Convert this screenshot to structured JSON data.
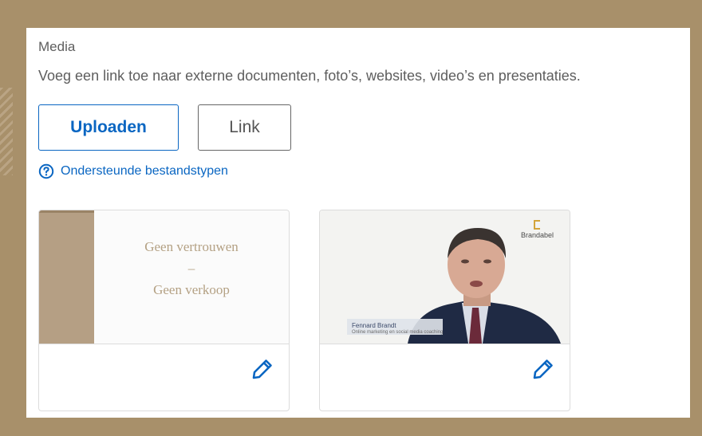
{
  "media": {
    "title": "Media",
    "description": "Voeg een link toe naar externe documenten, foto’s, websites, video’s en presentaties.",
    "upload_label": "Uploaden",
    "link_label": "Link",
    "help_label": "Ondersteunde bestandstypen"
  },
  "cards": [
    {
      "kind": "slide",
      "line1": "Geen vertrouwen",
      "line2": "–",
      "line3": "Geen verkoop",
      "edit_icon": "pencil-icon"
    },
    {
      "kind": "video",
      "logo_text": "Brandabel",
      "lower_name": "Fennard Brandt",
      "lower_sub": "Online marketing en social media coaching",
      "edit_icon": "pencil-icon"
    }
  ],
  "colors": {
    "accent": "#0a66c2",
    "frame": "#a8906a",
    "slide_band": "#b59f84",
    "slide_text": "#b4a184"
  }
}
